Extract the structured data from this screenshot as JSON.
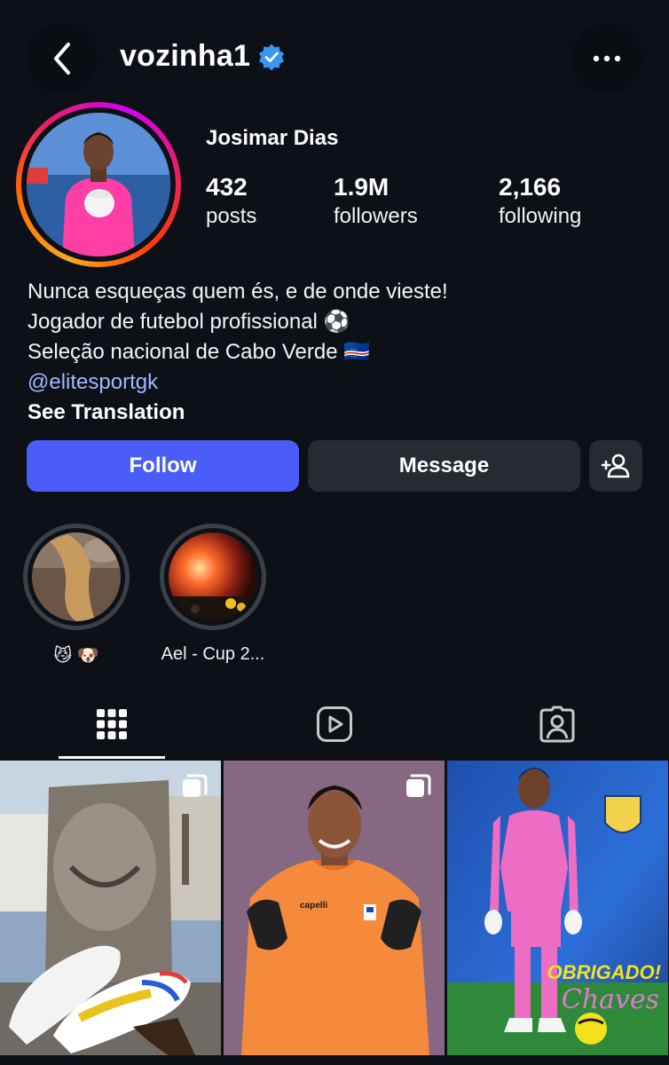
{
  "header": {
    "username": "vozinha1",
    "back_icon": "chevron-left-icon",
    "verified_icon": "verified-badge-icon",
    "more_icon": "more-horizontal-icon"
  },
  "profile": {
    "full_name": "Josimar Dias",
    "stats": [
      {
        "value": "432",
        "label": "posts"
      },
      {
        "value": "1.9M",
        "label": "followers"
      },
      {
        "value": "2,166",
        "label": "following"
      }
    ],
    "bio_lines": [
      "Nunca esqueças quem és, e de onde vieste!",
      "Jogador de futebol profissional ⚽",
      "Seleção nacional de Cabo Verde 🇨🇻"
    ],
    "link": "@elitesportgk",
    "see_translation": "See Translation"
  },
  "actions": {
    "follow": "Follow",
    "message": "Message",
    "add_user_icon": "add-user-icon"
  },
  "highlights": [
    {
      "label": "😼 🐶"
    },
    {
      "label": "Ael - Cup 2..."
    }
  ],
  "tabs": [
    {
      "icon": "grid-icon",
      "active": true
    },
    {
      "icon": "reels-icon",
      "active": false
    },
    {
      "icon": "tagged-icon",
      "active": false
    }
  ],
  "posts": [
    {
      "multi": true
    },
    {
      "multi": true,
      "jersey_text": "capelli"
    },
    {
      "multi": false,
      "overlay_title": "OBRIGADO!",
      "overlay_sub": "Chaves"
    }
  ],
  "colors": {
    "background": "#0d1117",
    "follow_button": "#4a5df9",
    "secondary_button": "#262a31",
    "link": "#a3b7ff",
    "verified": "#3897f0"
  }
}
